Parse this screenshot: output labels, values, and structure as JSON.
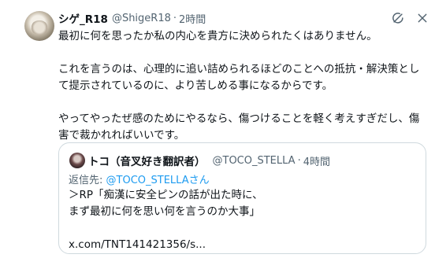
{
  "tweet": {
    "display_name": "シゲ_R18",
    "handle": "@ShigeR18",
    "separator": "·",
    "time": "2時間",
    "paragraphs": [
      [
        "最初に何を思ったか私の内心を貴方に決められたくはありません。"
      ],
      [
        "これを言うのは、心理的に追い詰められるほどのことへの抵抗・解決策とし",
        "て提示されているのに、より苦しめる事になるからです。"
      ],
      [
        "やってやったぜ感のためにやるなら、傷つけることを軽く考えすぎだし、傷",
        "害で裁かれればいいです。"
      ]
    ]
  },
  "quote": {
    "display_name": "トコ（音叉好き翻訳者）",
    "handle": "@TOCO_STELLA",
    "separator": "·",
    "time": "4時間",
    "reply_prefix": "返信先: ",
    "reply_mention": "@TOCO_STELLAさん",
    "lines": [
      "＞RP「痴漢に安全ピンの話が出た時に、",
      "まず最初に何を思い何を言うのか大事」",
      "",
      "x.com/TNT141421356/s..."
    ]
  },
  "icons": {
    "grok": "grok-icon",
    "close": "close-icon"
  },
  "colors": {
    "text": "#0f1419",
    "secondary": "#536471",
    "accent": "#1d9bf0",
    "border": "#cfd9de"
  }
}
